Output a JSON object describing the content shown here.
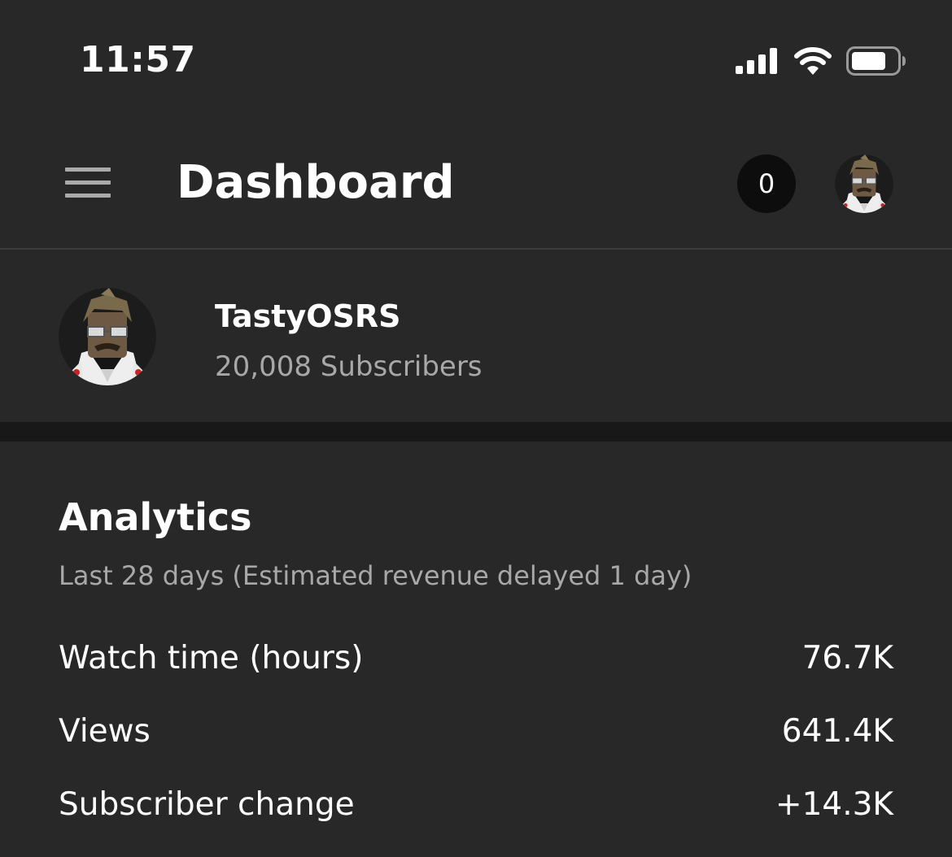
{
  "status_bar": {
    "time": "11:57",
    "icons": [
      "signal-icon",
      "wifi-icon",
      "battery-icon"
    ]
  },
  "header": {
    "title": "Dashboard",
    "notification_count": "0",
    "menu_icon": "hamburger-menu-icon",
    "avatar": "account-avatar"
  },
  "channel": {
    "name": "TastyOSRS",
    "subscribers": "20,008 Subscribers"
  },
  "analytics": {
    "title": "Analytics",
    "subtitle": "Last 28 days (Estimated revenue delayed 1 day)",
    "metrics": [
      {
        "label": "Watch time (hours)",
        "value": "76.7K"
      },
      {
        "label": "Views",
        "value": "641.4K"
      },
      {
        "label": "Subscriber change",
        "value": "+14.3K"
      }
    ]
  },
  "colors": {
    "background": "#282828",
    "divider": "#181818",
    "secondary_text": "#a8a8a8",
    "badge_background": "#0d0d0d"
  }
}
